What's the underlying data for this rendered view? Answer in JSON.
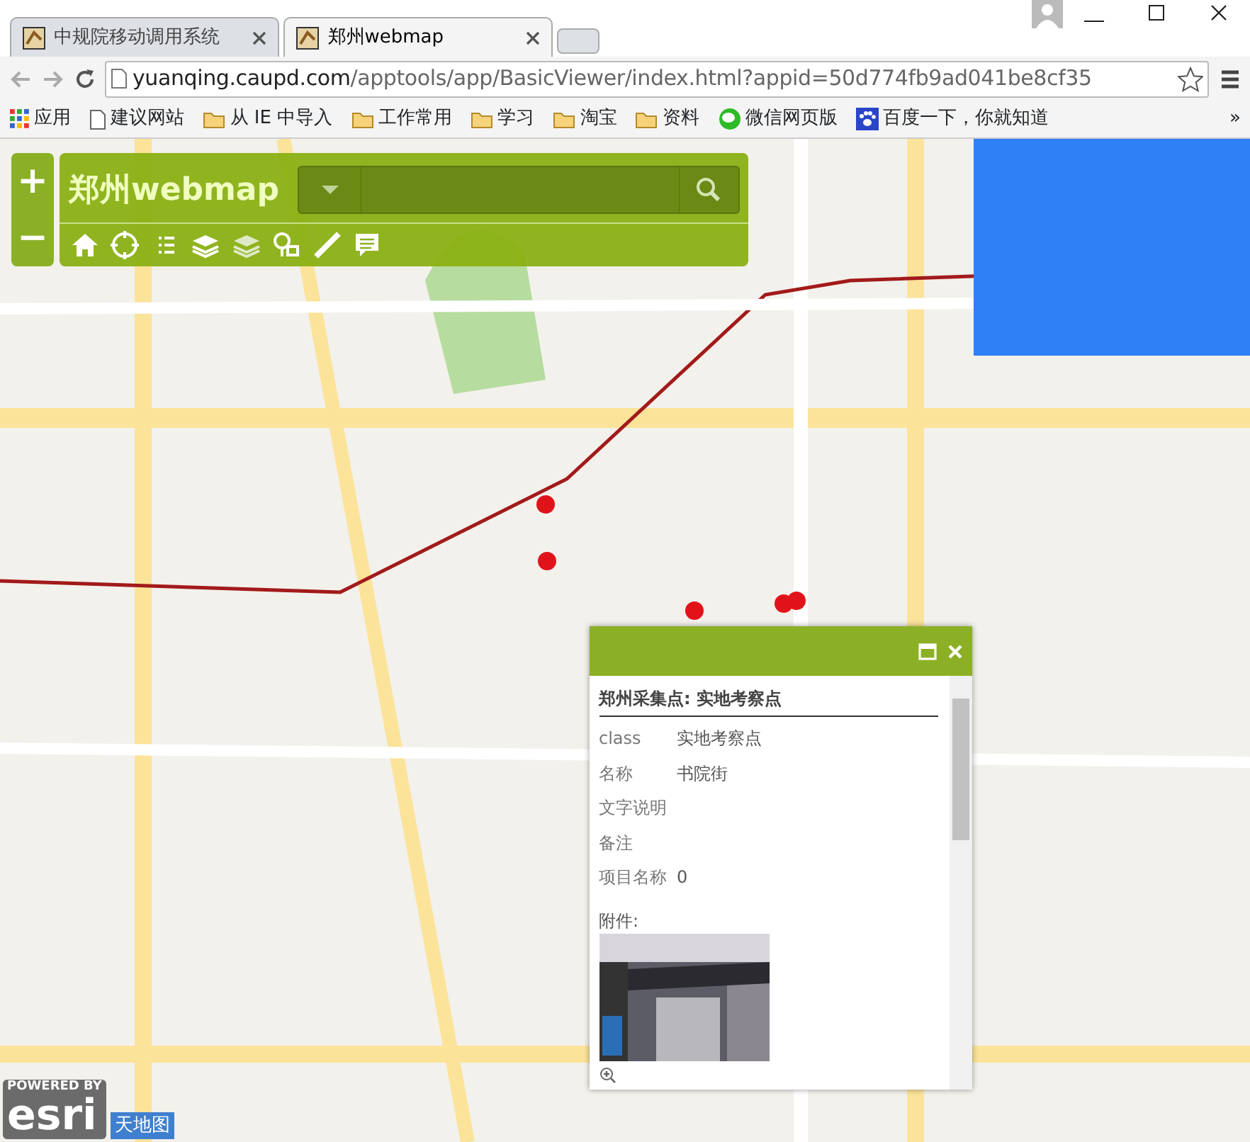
{
  "browser": {
    "tabs": [
      {
        "title": "中规院移动调用系统",
        "selected": false
      },
      {
        "title": "郑州webmap",
        "selected": true
      }
    ],
    "address": {
      "host": "yuanqing.caupd.com",
      "path": "/apptools/app/BasicViewer/index.html?appid=50d774fb9ad041be8cf35"
    },
    "bookmarks": [
      {
        "label": "应用",
        "kind": "apps"
      },
      {
        "label": "建议网站",
        "kind": "page"
      },
      {
        "label": "从 IE 中导入",
        "kind": "folder"
      },
      {
        "label": "工作常用",
        "kind": "folder"
      },
      {
        "label": "学习",
        "kind": "folder"
      },
      {
        "label": "淘宝",
        "kind": "folder"
      },
      {
        "label": "资料",
        "kind": "folder"
      },
      {
        "label": "微信网页版",
        "kind": "chat"
      },
      {
        "label": "百度一下，你就知道",
        "kind": "paw"
      }
    ],
    "more": "»"
  },
  "map": {
    "title": "郑州webmap",
    "zoom_in": "+",
    "zoom_out": "−",
    "popup": {
      "title": "郑州采集点: 实地考察点",
      "fields": [
        {
          "label": "class",
          "value": "实地考察点"
        },
        {
          "label": "名称",
          "value": "书院街"
        },
        {
          "label": "文字说明"
        },
        {
          "label": "备注"
        },
        {
          "label": "项目名称",
          "value": "0"
        }
      ],
      "attachments_label": "附件:"
    },
    "attribution": {
      "powered_by": "POWERED BY",
      "logo": "esri",
      "source": "天地图"
    }
  }
}
